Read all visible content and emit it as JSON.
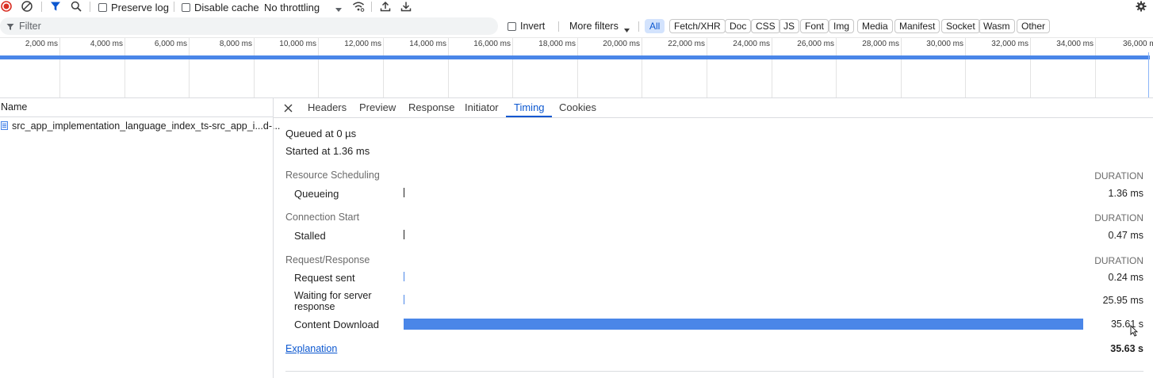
{
  "toolbar": {
    "preserve_log": "Preserve log",
    "disable_cache": "Disable cache",
    "throttling": "No throttling"
  },
  "filter": {
    "placeholder": "Filter",
    "invert": "Invert",
    "more_filters": "More filters",
    "chips": [
      "All",
      "Fetch/XHR",
      "Doc",
      "CSS",
      "JS",
      "Font",
      "Img",
      "Media",
      "Manifest",
      "Socket",
      "Wasm",
      "Other"
    ],
    "active_chip": "All"
  },
  "timeline": {
    "ticks": [
      "2,000 ms",
      "4,000 ms",
      "6,000 ms",
      "8,000 ms",
      "10,000 ms",
      "12,000 ms",
      "14,000 ms",
      "16,000 ms",
      "18,000 ms",
      "20,000 ms",
      "22,000 ms",
      "24,000 ms",
      "26,000 ms",
      "28,000 ms",
      "30,000 ms",
      "32,000 ms",
      "34,000 ms",
      "36,000 m"
    ]
  },
  "requests": {
    "column_name": "Name",
    "items": [
      "src_app_implementation_language_index_ts-src_app_i...d-..."
    ]
  },
  "details": {
    "tabs": [
      "Headers",
      "Preview",
      "Response",
      "Initiator",
      "Timing",
      "Cookies"
    ],
    "active_tab": "Timing",
    "queued_at": "Queued at 0 µs",
    "started_at": "Started at 1.36 ms",
    "sections": [
      {
        "title": "Resource Scheduling",
        "duration_label": "DURATION",
        "rows": [
          {
            "label": "Queueing",
            "value": "1.36 ms"
          }
        ]
      },
      {
        "title": "Connection Start",
        "duration_label": "DURATION",
        "rows": [
          {
            "label": "Stalled",
            "value": "0.47 ms"
          }
        ]
      },
      {
        "title": "Request/Response",
        "duration_label": "DURATION",
        "rows": [
          {
            "label": "Request sent",
            "value": "0.24 ms"
          },
          {
            "label": "Waiting for server response",
            "value": "25.95 ms"
          },
          {
            "label": "Content Download",
            "value": "35.61 s"
          }
        ]
      }
    ],
    "explanation": "Explanation",
    "total": "35.63 s"
  },
  "colors": {
    "accent": "#0b57d0",
    "bar_blue": "#4a86e8",
    "record_red": "#d93025"
  }
}
